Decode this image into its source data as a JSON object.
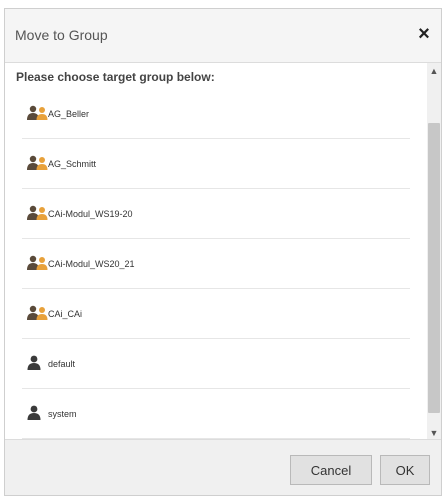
{
  "dialog": {
    "title": "Move to Group",
    "close_glyph": "×"
  },
  "prompt": "Please choose target group below:",
  "groups": [
    {
      "label": "AG_Beller",
      "icon": "user-group-icon"
    },
    {
      "label": "AG_Schmitt",
      "icon": "user-group-icon"
    },
    {
      "label": "CAi-Modul_WS19-20",
      "icon": "user-group-icon"
    },
    {
      "label": "CAi-Modul_WS20_21",
      "icon": "user-group-icon"
    },
    {
      "label": "CAi_CAi",
      "icon": "user-group-icon"
    },
    {
      "label": "default",
      "icon": "user-icon"
    },
    {
      "label": "system",
      "icon": "user-icon"
    }
  ],
  "scrollbar": {
    "up_glyph": "▲",
    "down_glyph": "▼"
  },
  "footer": {
    "cancel_label": "Cancel",
    "ok_label": "OK"
  },
  "colors": {
    "group_icon_dark": "#5a4a3a",
    "group_icon_orange": "#e8a13a",
    "user_icon": "#3a3a3a"
  }
}
